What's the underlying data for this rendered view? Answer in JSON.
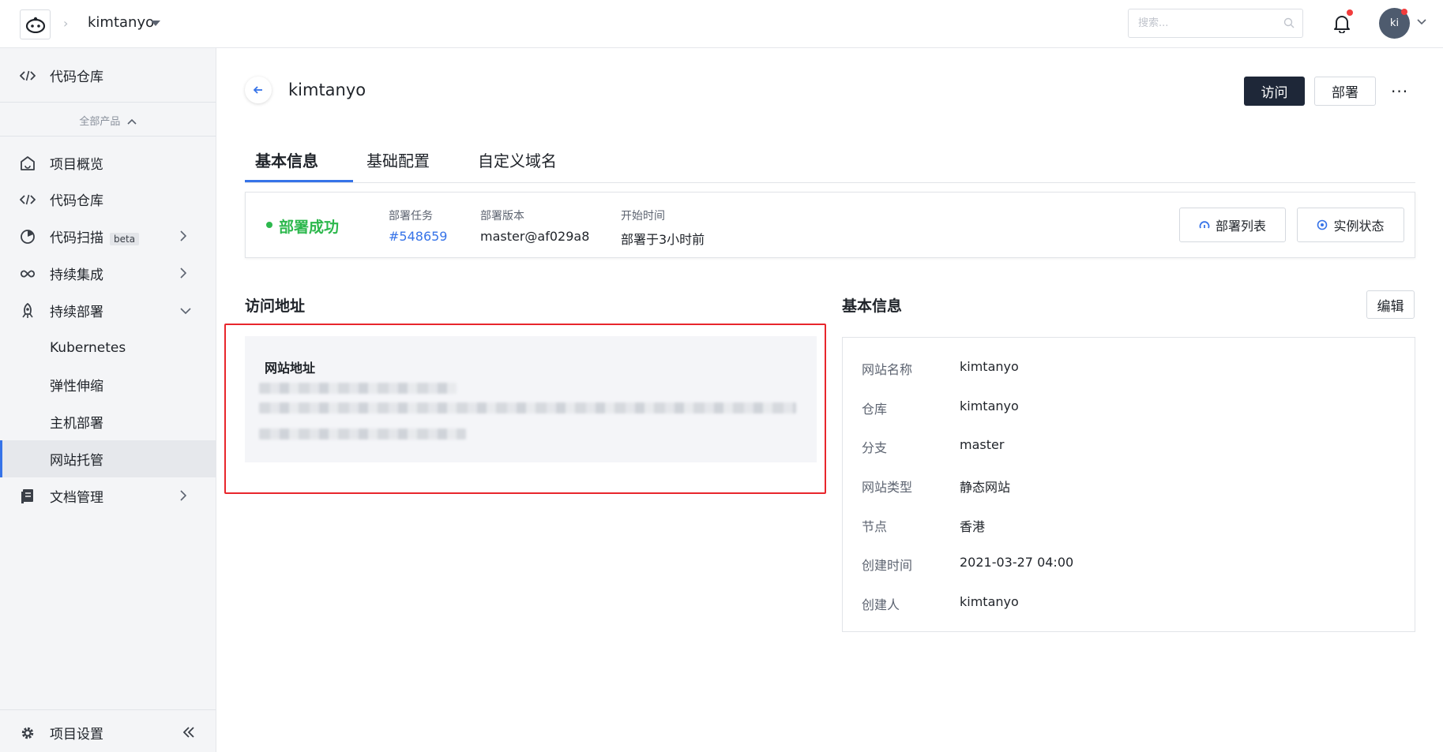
{
  "topbar": {
    "project_name": "kimtanyo",
    "search_placeholder": "搜索...",
    "avatar_initials": "ki"
  },
  "sidebar": {
    "top_item": "代码仓库",
    "all_products": "全部产品",
    "items": [
      {
        "label": "项目概览",
        "icon": "home-icon"
      },
      {
        "label": "代码仓库",
        "icon": "code-icon"
      },
      {
        "label": "代码扫描",
        "icon": "scan-icon",
        "badge": "beta"
      },
      {
        "label": "持续集成",
        "icon": "infinity-icon"
      },
      {
        "label": "持续部署",
        "icon": "rocket-icon"
      }
    ],
    "sub_items": [
      "Kubernetes",
      "弹性伸缩",
      "主机部署",
      "网站托管"
    ],
    "active_sub": "网站托管",
    "docs": "文档管理",
    "settings": "项目设置"
  },
  "header": {
    "title": "kimtanyo",
    "visit_label": "访问",
    "deploy_label": "部署",
    "more_label": "···"
  },
  "tabs": [
    {
      "label": "基本信息",
      "active": true
    },
    {
      "label": "基础配置",
      "active": false
    },
    {
      "label": "自定义域名",
      "active": false
    }
  ],
  "status": {
    "text": "部署成功",
    "color": "#2db84d",
    "task_label": "部署任务",
    "task_value": "#548659",
    "version_label": "部署版本",
    "version_value": "master@af029a8",
    "time_label": "开始时间",
    "time_value": "部署于3小时前",
    "deploy_list_label": "部署列表",
    "instance_status_label": "实例状态"
  },
  "access": {
    "title": "访问地址",
    "site_url_label": "网站地址"
  },
  "basic_info": {
    "title": "基本信息",
    "edit_label": "编辑",
    "rows": [
      {
        "key": "网站名称",
        "value": "kimtanyo"
      },
      {
        "key": "仓库",
        "value": "kimtanyo"
      },
      {
        "key": "分支",
        "value": "master"
      },
      {
        "key": "网站类型",
        "value": "静态网站"
      },
      {
        "key": "节点",
        "value": "香港"
      },
      {
        "key": "创建时间",
        "value": "2021-03-27 04:00"
      },
      {
        "key": "创建人",
        "value": "kimtanyo"
      }
    ]
  },
  "colors": {
    "accent": "#3673e8",
    "primary_button": "#1e2738",
    "highlight_box": "#e8262c",
    "notification_dot": "#f23c3c"
  }
}
